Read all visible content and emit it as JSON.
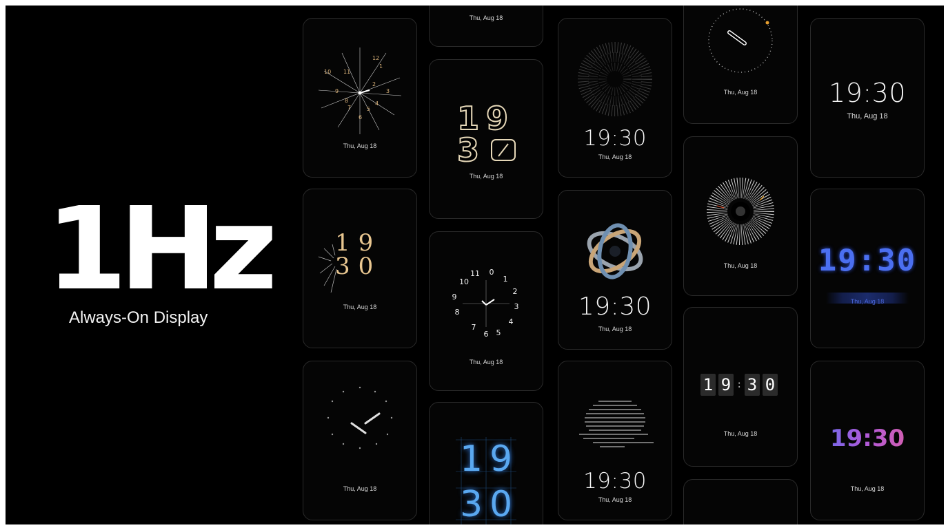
{
  "hero": {
    "title": "1Hz",
    "subtitle": "Always-On Display"
  },
  "date_label": "Thu, Aug 18",
  "time": "19:30",
  "hour": "19",
  "minute": "30",
  "flip_digits": [
    "1",
    "9",
    "3",
    "0"
  ],
  "dial_numbers": [
    "11",
    "12",
    "1",
    "2",
    "3",
    "4",
    "5",
    "6",
    "7",
    "8",
    "9",
    "10"
  ],
  "colors": {
    "background": "#000000",
    "card_border": "#2a2a2a",
    "gold": "#d9b27a",
    "blue": "#4b6ff0",
    "purple": "#a05ae0"
  }
}
